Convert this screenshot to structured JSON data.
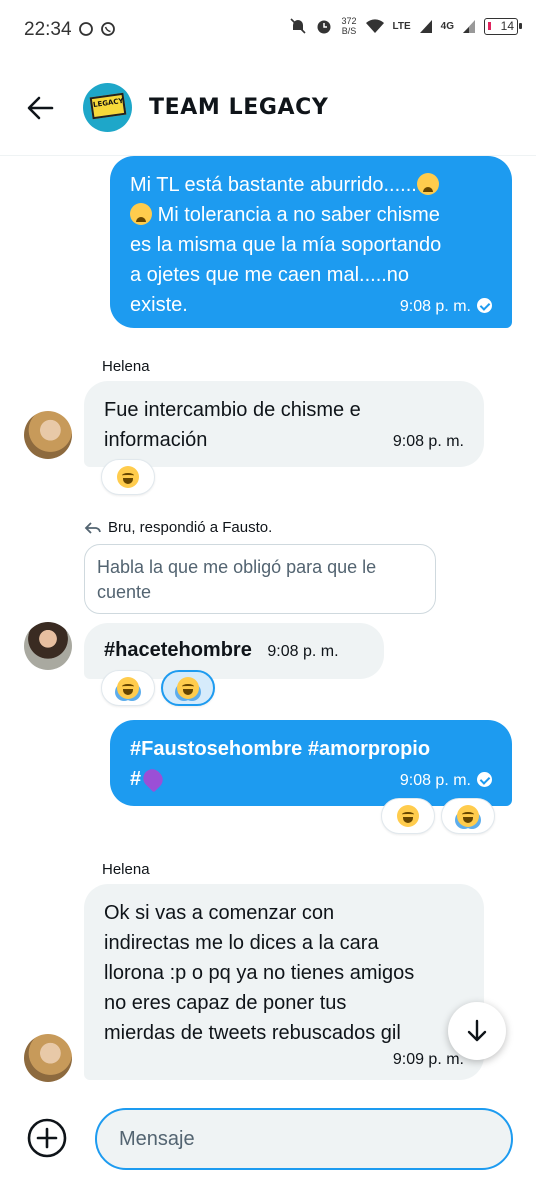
{
  "status_bar": {
    "time": "22:34",
    "net_speed": "372",
    "net_speed_unit": "B/S",
    "network_lte": "LTE",
    "network_4g": "4G",
    "battery": "14"
  },
  "header": {
    "title": "TEAM LEGACY",
    "avatar_text": "LEGACY"
  },
  "messages": [
    {
      "direction": "out",
      "text_lines": [
        "Mi TL está bastante aburrido......",
        "Mi tolerancia a no saber chisme",
        "es la misma que la mía soportando",
        "a ojetes que me caen mal.....no",
        "existe."
      ],
      "time": "9:08 p. m."
    },
    {
      "sender": "Helena",
      "direction": "in",
      "text_lines": [
        "Fue intercambio de chisme e",
        "información"
      ],
      "time": "9:08 p. m."
    },
    {
      "reply_note": "Bru, respondió a Fausto.",
      "quote": "Habla la que me obligó para que le cuente",
      "direction": "in",
      "text": "#hacetehombre",
      "time": "9:08 p. m."
    },
    {
      "direction": "out",
      "text_line1": "#Faustosehombre #amorpropio",
      "text_line2": "#",
      "time": "9:08 p. m."
    },
    {
      "sender": "Helena",
      "direction": "in",
      "text_lines": [
        "Ok si vas a comenzar con",
        "indirectas me lo dices a la cara",
        "llorona :p o pq ya no tienes amigos",
        "no eres capaz de poner tus",
        "mierdas de tweets rebuscados gil"
      ],
      "time": "9:09 p. m."
    }
  ],
  "composer": {
    "placeholder": "Mensaje"
  },
  "colors": {
    "accent": "#1d9bf0",
    "incoming_bubble": "#eff3f4"
  }
}
